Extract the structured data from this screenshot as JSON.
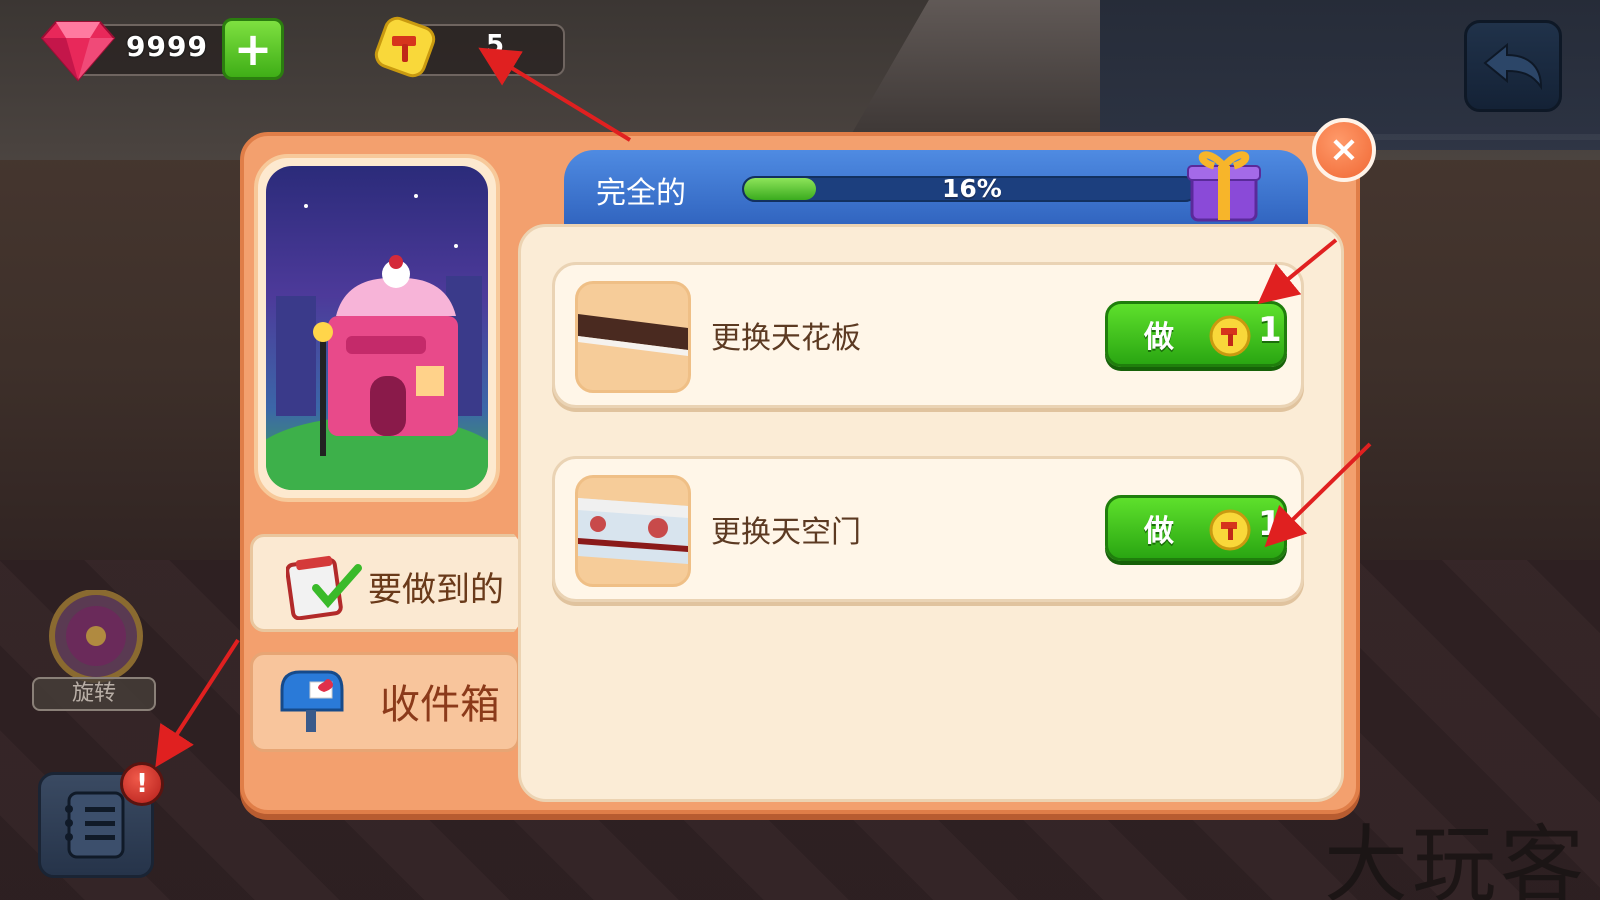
{
  "hud": {
    "gems": "9999",
    "hammers": "5",
    "plus_symbol": "+"
  },
  "panel": {
    "progress_title": "完全的",
    "progress_percent": "16%",
    "progress_value": 0.16,
    "close_symbol": "×"
  },
  "tabs": {
    "todo_label": "要做到的",
    "inbox_label": "收件箱"
  },
  "tasks": [
    {
      "name": "更换天花板",
      "button_label": "做",
      "cost": "1"
    },
    {
      "name": "更换天空门",
      "button_label": "做",
      "cost": "1"
    }
  ],
  "side": {
    "spin_label": "旋转",
    "alert_symbol": "!"
  },
  "watermark": "大玩客",
  "colors": {
    "panel_orange": "#f3a06e",
    "header_blue": "#2f62bd",
    "button_green": "#2aa612",
    "arrow_red": "#e02020"
  }
}
